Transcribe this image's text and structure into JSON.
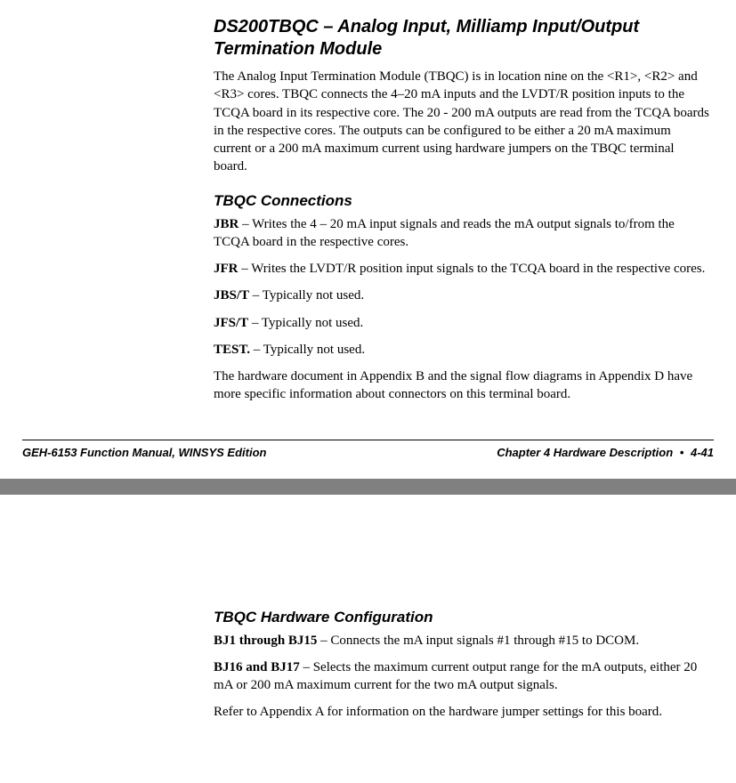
{
  "page1": {
    "module_title": "DS200TBQC – Analog Input, Milliamp Input/Output Termination Module",
    "intro": "The Analog Input Termination Module (TBQC) is in location nine on the <R1>, <R2> and <R3> cores. TBQC connects the 4–20 mA inputs and the LVDT/R position inputs to the TCQA board in its respective core. The 20 - 200 mA outputs are read from the TCQA boards in the respective cores. The outputs can be configured to be either a 20 mA maximum current or a 200 mA maximum current using hardware jumpers on the TBQC terminal board.",
    "connections_heading": "TBQC Connections",
    "connections": [
      {
        "term": "JBR",
        "sep": " – ",
        "desc": "Writes the 4 – 20 mA input signals and reads the mA output signals to/from the TCQA board in the respective cores."
      },
      {
        "term": "JFR",
        "sep": " – ",
        "desc": "Writes the LVDT/R position input signals to the TCQA board in the respective cores."
      },
      {
        "term": "JBS/T",
        "sep": " – ",
        "desc": "Typically not used."
      },
      {
        "term": "JFS/T",
        "sep": " – ",
        "desc": "Typically not used."
      },
      {
        "term": "TEST.",
        "sep": " – ",
        "desc": "Typically not used."
      }
    ],
    "outro": "The hardware document in Appendix B and the signal flow diagrams in Appendix D have more specific information about connectors on this terminal board."
  },
  "footer": {
    "left": "GEH-6153   Function Manual, WINSYS Edition",
    "right_chapter": "Chapter 4   Hardware Description",
    "bullet": "•",
    "right_page": "4-41"
  },
  "page2": {
    "hwcfg_heading": "TBQC Hardware Configuration",
    "items": [
      {
        "term": "BJ1 through BJ15",
        "sep": " – ",
        "desc": "Connects the mA input signals #1 through #15  to  DCOM."
      },
      {
        "term": "BJ16 and BJ17",
        "sep": " – ",
        "desc": "Selects the maximum current output range for the mA outputs, either 20 mA or 200 mA maximum current for the two mA output signals."
      }
    ],
    "outro": "Refer to Appendix A for information on the hardware jumper settings for this board."
  }
}
